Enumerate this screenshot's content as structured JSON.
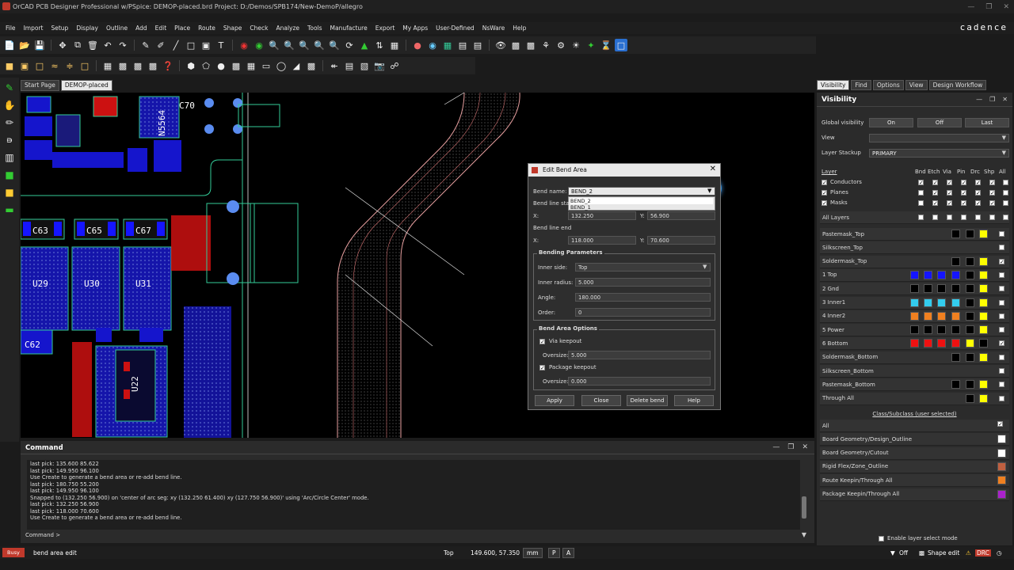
{
  "window": {
    "title": "OrCAD PCB Designer Professional w/PSpice: DEMOP-placed.brd  Project: D:/Demos/SPB174/New-DemoP/allegro",
    "brand": "cadence"
  },
  "menu": [
    "File",
    "Import",
    "Setup",
    "Display",
    "Outline",
    "Add",
    "Edit",
    "Place",
    "Route",
    "Shape",
    "Check",
    "Analyze",
    "Tools",
    "Manufacture",
    "Export",
    "My Apps",
    "User-Defined",
    "NsWare",
    "Help"
  ],
  "tabs": [
    "Start Page",
    "DEMOP-placed"
  ],
  "right_tabs": [
    "Visibility",
    "Find",
    "Options",
    "View",
    "Design Workflow"
  ],
  "canvas_labels": [
    "C70",
    "C63",
    "C65",
    "C67",
    "U29",
    "U30",
    "U31",
    "C62",
    "U22",
    "N5564"
  ],
  "command": {
    "title": "Command",
    "log": [
      "last pick:  135.600 85.622",
      "last pick:  149.950 96.100",
      "Use Create to generate a bend area or re-add bend line.",
      "last pick:  180.750 55.200",
      "last pick:  149.950 96.100",
      "Snapped to (132.250 56.900) on 'center of arc seg: xy (132.250 61.400) xy (127.750 56.900)' using 'Arc/Circle Center' mode.",
      "last pick:  132.250 56.900",
      "last pick:  118.000 70.600",
      "Use Create to generate a bend area or re-add bend line."
    ],
    "prompt": "Command >"
  },
  "status": {
    "busy": "Busy",
    "mode": "bend area edit",
    "layer": "Top",
    "coords": "149.600, 57.350",
    "units": "mm",
    "p": "P",
    "a": "A",
    "off": "Off",
    "shape_edit": "Shape edit",
    "drc": "DRC"
  },
  "visibility": {
    "title": "Visibility",
    "global_label": "Global visibility",
    "on": "On",
    "off": "Off",
    "last": "Last",
    "view_label": "View",
    "view_value": "",
    "stackup_label": "Layer Stackup",
    "stackup_value": "PRIMARY",
    "layer_header": "Layer",
    "cols": [
      "Bnd",
      "Etch",
      "Via",
      "Pin",
      "Drc",
      "Shp",
      "All"
    ],
    "groups": [
      "Conductors",
      "Planes",
      "Masks"
    ],
    "all_layers": "All Layers",
    "layers": [
      {
        "name": "Pastemask_Top",
        "colors": [
          "#000000",
          "#000000",
          "#ffff00"
        ],
        "all": false
      },
      {
        "name": "Silkscreen_Top",
        "colors": [],
        "all": false
      },
      {
        "name": "Soldermask_Top",
        "colors": [
          "#000000",
          "#000000",
          "#ffff00"
        ],
        "all": true
      },
      {
        "name": "1 Top",
        "colors": [
          "#1515ff",
          "#1515ff",
          "#1515ff",
          "#1515ff",
          "#000000",
          "#ffff00"
        ],
        "all": false
      },
      {
        "name": "2 Gnd",
        "colors": [
          "#000000",
          "#000000",
          "#000000",
          "#000000",
          "#000000",
          "#ffff00"
        ],
        "all": false
      },
      {
        "name": "3 Inner1",
        "colors": [
          "#33ccee",
          "#33ccee",
          "#33ccee",
          "#33ccee",
          "#000000",
          "#ffff00"
        ],
        "all": false
      },
      {
        "name": "4 Inner2",
        "colors": [
          "#f08020",
          "#f08020",
          "#f08020",
          "#f08020",
          "#000000",
          "#ffff00"
        ],
        "all": false
      },
      {
        "name": "5 Power",
        "colors": [
          "#000000",
          "#000000",
          "#000000",
          "#000000",
          "#000000",
          "#ffff00"
        ],
        "all": false
      },
      {
        "name": "6 Bottom",
        "colors": [
          "#ee1111",
          "#ee1111",
          "#ee1111",
          "#ee1111",
          "#ffff00",
          "#000000"
        ],
        "all": true
      },
      {
        "name": "Soldermask_Bottom",
        "colors": [
          "#000000",
          "#000000",
          "#ffff00"
        ],
        "all": false
      },
      {
        "name": "Silkscreen_Bottom",
        "colors": [],
        "all": false
      },
      {
        "name": "Pastemask_Bottom",
        "colors": [
          "#000000",
          "#000000",
          "#ffff00"
        ],
        "all": false
      },
      {
        "name": "Through All",
        "colors": [
          "#000000",
          "#ffff00"
        ],
        "all": false
      }
    ],
    "class_link": "Class/Subclass (user selected)",
    "classes": [
      {
        "name": "All",
        "color": ""
      },
      {
        "name": "Board Geometry/Design_Outline",
        "color": "#ffffff"
      },
      {
        "name": "Board Geometry/Cutout",
        "color": "#ffffff"
      },
      {
        "name": "Rigid Flex/Zone_Outline",
        "color": "#c06040"
      },
      {
        "name": "Route Keepin/Through All",
        "color": "#f08020"
      },
      {
        "name": "Package Keepin/Through All",
        "color": "#aa22cc"
      }
    ],
    "enable_layer_select": "Enable layer select mode"
  },
  "dialog": {
    "title": "Edit Bend Area",
    "bend_name_label": "Bend name:",
    "bend_name_value": "BEND_2",
    "bend_options": [
      "BEND_2",
      "BEND_1"
    ],
    "bend_line_start_label": "Bend line sta",
    "start_x": "132.250",
    "start_y": "56.900",
    "bend_line_end_label": "Bend line end",
    "end_x": "118.000",
    "end_y": "70.600",
    "x_label": "X:",
    "y_label": "Y:",
    "bending_params_label": "Bending Parameters",
    "inner_side_label": "Inner side:",
    "inner_side_value": "Top",
    "inner_radius_label": "Inner radius:",
    "inner_radius_value": "5.000",
    "angle_label": "Angle:",
    "angle_value": "180.000",
    "order_label": "Order:",
    "order_value": "0",
    "options_label": "Bend Area Options",
    "via_keepout_label": "Via keepout",
    "via_oversize_label": "Oversize:",
    "via_oversize_value": "5.000",
    "package_keepout_label": "Package keepout",
    "pkg_oversize_label": "Oversize:",
    "pkg_oversize_value": "0.000",
    "buttons": [
      "Apply",
      "Close",
      "Delete bend",
      "Help"
    ]
  }
}
